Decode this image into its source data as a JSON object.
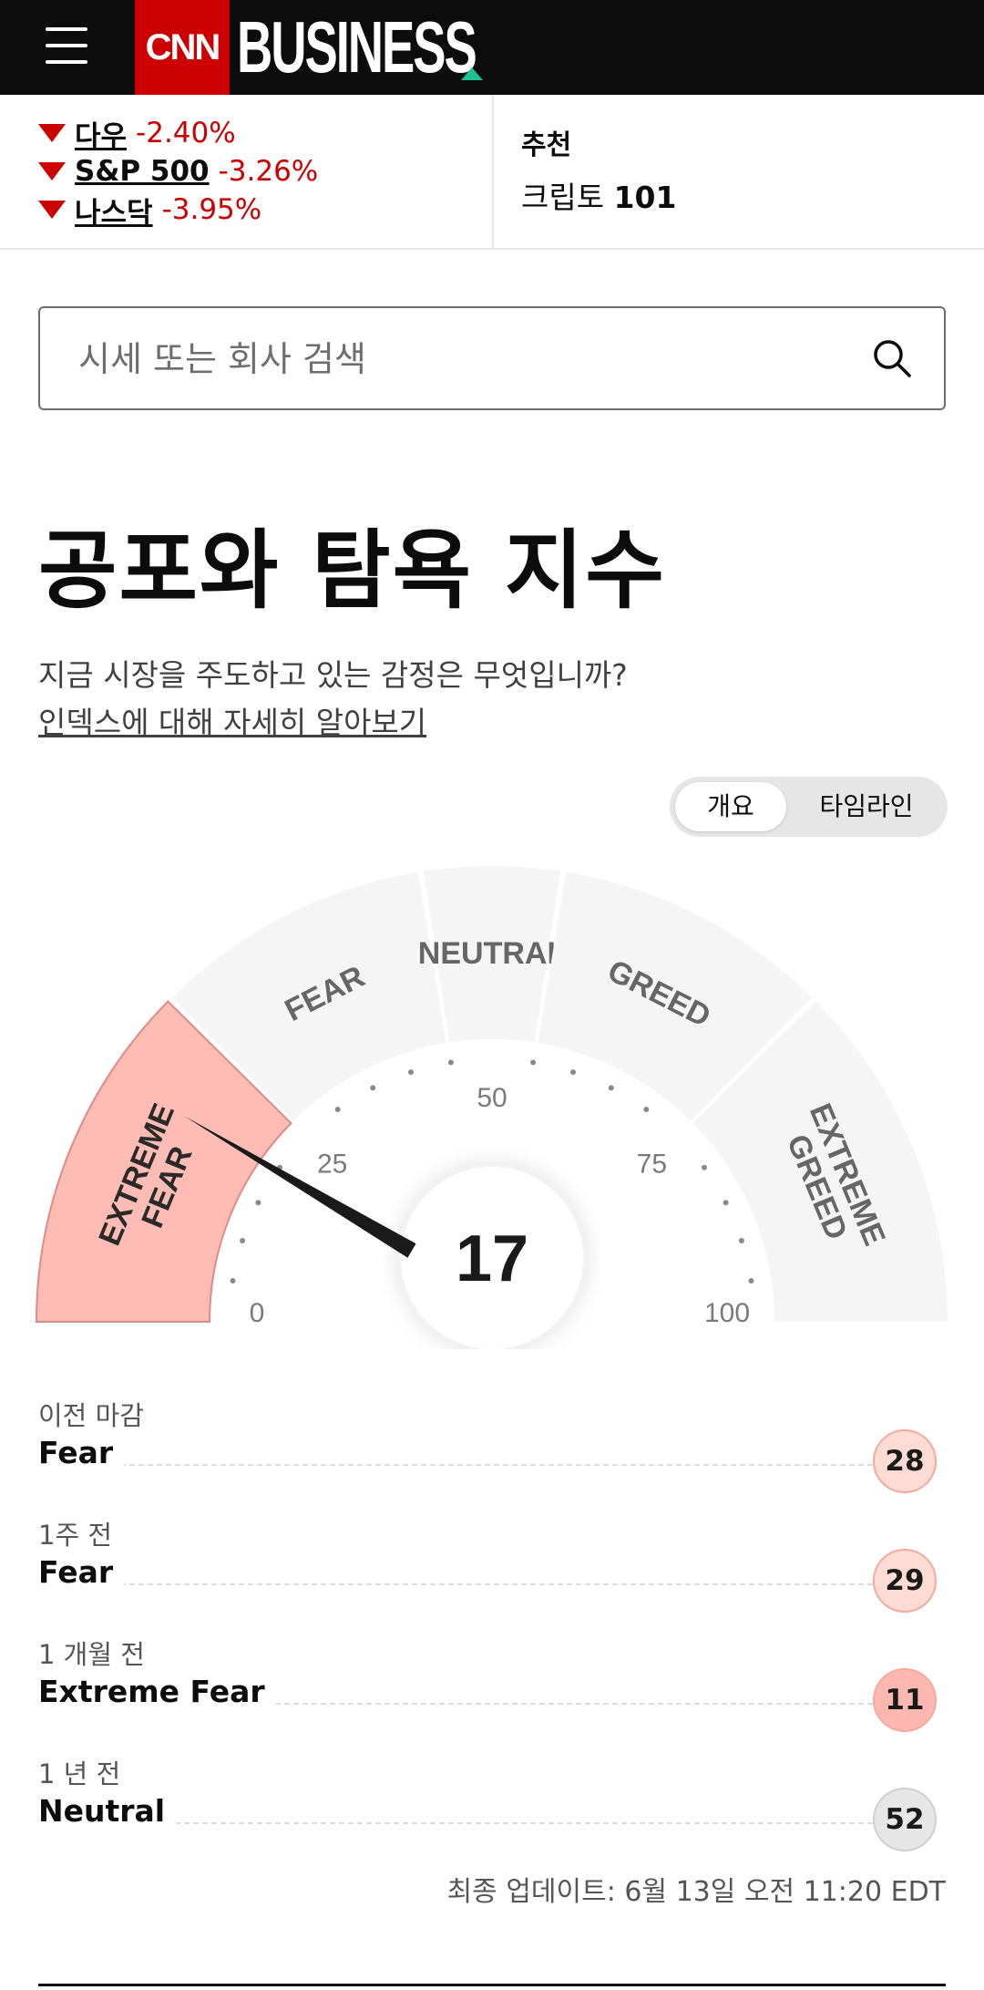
{
  "header": {
    "logo_cnn": "CNN",
    "logo_business": "BUSINESS",
    "accent_color": "#cc0000"
  },
  "markets": [
    {
      "name": "다우",
      "change": "-2.40%",
      "direction": "down"
    },
    {
      "name": "S&P 500",
      "change": "-3.26%",
      "direction": "down"
    },
    {
      "name": "나스닥",
      "change": "-3.95%",
      "direction": "down"
    }
  ],
  "recommended": {
    "title": "추천",
    "item_prefix": "크립토",
    "item_number": "101"
  },
  "search": {
    "placeholder": "시세 또는 회사 검색"
  },
  "page": {
    "title": "공포와 탐욕 지수",
    "subtitle": "지금 시장을 주도하고 있는 감정은 무엇입니까?",
    "learn_link": "인덱스에 대해 자세히 알아보기"
  },
  "view_toggle": {
    "options": [
      "개요",
      "타임라인"
    ],
    "selected": "개요"
  },
  "gauge": {
    "value": 17,
    "scale_min": 0,
    "scale_max": 100,
    "ticks": [
      "0",
      "25",
      "50",
      "75",
      "100"
    ],
    "segments": [
      {
        "lines": [
          "EXTREME",
          "FEAR"
        ],
        "from": 0,
        "to": 25,
        "active": true
      },
      {
        "lines": [
          "FEAR"
        ],
        "from": 25,
        "to": 45,
        "active": false
      },
      {
        "lines": [
          "NEUTRAL"
        ],
        "from": 45,
        "to": 55,
        "active": false
      },
      {
        "lines": [
          "GREED"
        ],
        "from": 55,
        "to": 75,
        "active": false
      },
      {
        "lines": [
          "EXTREME",
          "GREED"
        ],
        "from": 75,
        "to": 100,
        "active": false
      }
    ],
    "active_fill": "#ffbcb5",
    "inactive_fill": "#f5f5f5"
  },
  "history": [
    {
      "when": "이전 마감",
      "rating": "Fear",
      "value": "28",
      "color": "#fedcd3"
    },
    {
      "when": "1주 전",
      "rating": "Fear",
      "value": "29",
      "color": "#fedcd3"
    },
    {
      "when": "1 개월 전",
      "rating": "Extreme Fear",
      "value": "11",
      "color": "#ffb8b1"
    },
    {
      "when": "1 년 전",
      "rating": "Neutral",
      "value": "52",
      "color": "#e6e6e6"
    }
  ],
  "last_updated": "최종 업데이트: 6월 13일 오전 11:20 EDT"
}
